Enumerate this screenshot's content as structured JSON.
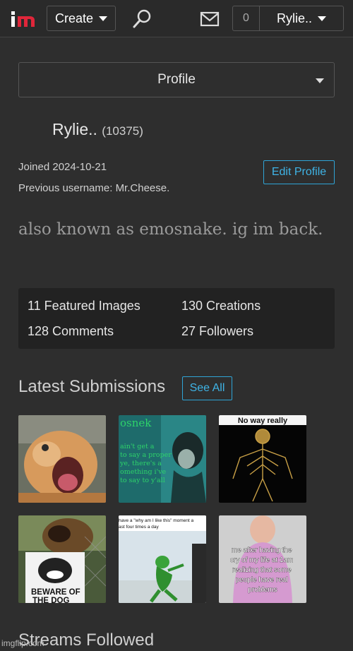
{
  "header": {
    "logo_text": "im",
    "create_label": "Create",
    "notif_count": "0",
    "user_label": "Rylie.."
  },
  "profile_select": {
    "label": "Profile"
  },
  "profile": {
    "username": "Rylie..",
    "points": "(10375)",
    "joined": "Joined 2024-10-21",
    "previous_username": "Previous username: Mr.Cheese.",
    "edit_label": "Edit Profile",
    "bio": "also known as emosnake. ig im back."
  },
  "stats": {
    "featured": "11 Featured Images",
    "creations": "130 Creations",
    "comments": "128 Comments",
    "followers": "27 Followers"
  },
  "latest": {
    "title": "Latest Submissions",
    "see_all": "See All",
    "thumbs": [
      {
        "name": "cat-meme-thumb"
      },
      {
        "name": "emosnek-template-thumb",
        "text_title": "osnek",
        "text_body": [
          "ain't get a",
          "to say a proper",
          "ye, there's a",
          "omething i've",
          "to say to y'all"
        ]
      },
      {
        "name": "nervous-system-thumb",
        "text": "No way really"
      },
      {
        "name": "beware-dog-thumb",
        "text": [
          "BEWARE OF",
          "THE DOG"
        ]
      },
      {
        "name": "kermit-thumb",
        "text": [
          "have a \"why am I like this\" moment a",
          "ast four times a day"
        ]
      },
      {
        "name": "crying-man-thumb",
        "text": [
          "me after having the",
          "cry of my life at 1am",
          "realizing that some",
          "people have real",
          "problems"
        ]
      }
    ]
  },
  "streams": {
    "title": "Streams Followed"
  },
  "watermark": "imgflip.com",
  "colors": {
    "accent": "#2fa4d6",
    "logo_red": "#e0263a",
    "background": "#2e2e2e"
  }
}
